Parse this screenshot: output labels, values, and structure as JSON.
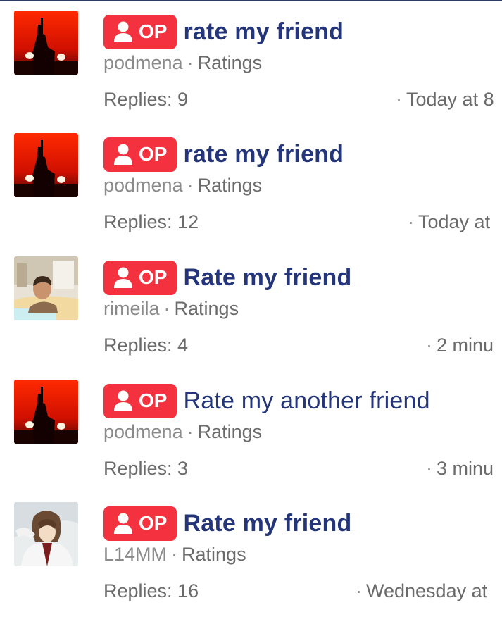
{
  "badge": {
    "label": "OP",
    "icon": "user-icon"
  },
  "colors": {
    "badge_bg": "#f3313f",
    "title": "#24357a",
    "meta": "#8a8a8a",
    "body": "#6b6b6b"
  },
  "threads": [
    {
      "title": "rate my friend",
      "author": "podmena",
      "forum": "Ratings",
      "replies": "Replies: 9",
      "last_post": "Today at 8",
      "avatar": "red-sunset-silhouette-avatar",
      "bold": true
    },
    {
      "title": "rate my friend",
      "author": "podmena",
      "forum": "Ratings",
      "replies": "Replies: 12",
      "last_post": "Today at",
      "avatar": "red-sunset-silhouette-avatar",
      "bold": true
    },
    {
      "title": "Rate my friend",
      "author": "rimeila",
      "forum": "Ratings",
      "replies": "Replies: 4",
      "last_post": "2 minu",
      "avatar": "person-photo-avatar",
      "bold": true
    },
    {
      "title": "Rate my another friend",
      "author": "podmena",
      "forum": "Ratings",
      "replies": "Replies: 3",
      "last_post": "3 minu",
      "avatar": "red-sunset-silhouette-avatar",
      "bold": false
    },
    {
      "title": "Rate my friend",
      "author": "L14MM",
      "forum": "Ratings",
      "replies": "Replies: 16",
      "last_post": "Wednesday at",
      "avatar": "anime-character-avatar",
      "bold": true
    }
  ]
}
